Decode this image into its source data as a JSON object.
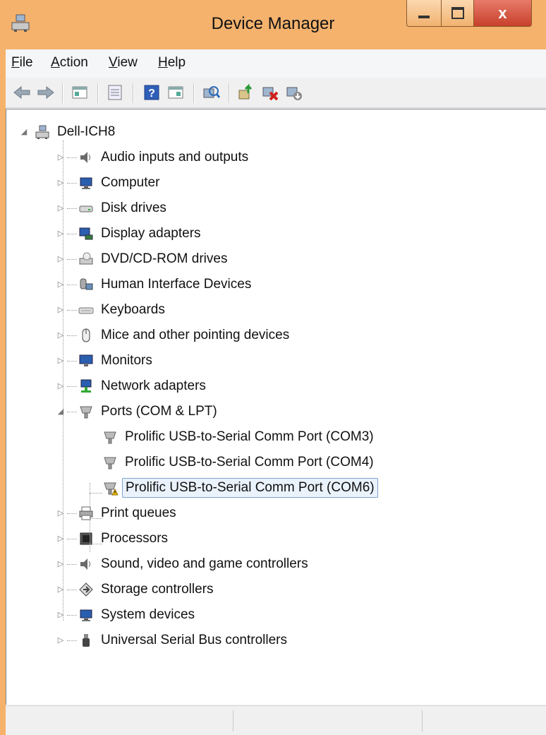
{
  "window": {
    "title": "Device Manager",
    "close_label": "x"
  },
  "menu": [
    {
      "label": "File",
      "accel": "F",
      "rest": "ile"
    },
    {
      "label": "Action",
      "accel": "A",
      "rest": "ction"
    },
    {
      "label": "View",
      "accel": "V",
      "rest": "iew"
    },
    {
      "label": "Help",
      "accel": "H",
      "rest": "elp"
    }
  ],
  "toolbar": [
    {
      "icon": "back-arrow-icon"
    },
    {
      "icon": "forward-arrow-icon"
    },
    {
      "icon": "show-hide-console-tree-icon"
    },
    {
      "icon": "properties-icon"
    },
    {
      "icon": "help-icon"
    },
    {
      "icon": "show-action-pane-icon"
    },
    {
      "icon": "scan-hardware-icon"
    },
    {
      "icon": "update-driver-icon"
    },
    {
      "icon": "uninstall-device-icon"
    },
    {
      "icon": "disable-device-icon"
    }
  ],
  "tree": {
    "root": "Dell-ICH8",
    "categories": [
      {
        "label": "Audio inputs and outputs",
        "icon": "speaker-icon",
        "expanded": false
      },
      {
        "label": "Computer",
        "icon": "computer-icon",
        "expanded": false
      },
      {
        "label": "Disk drives",
        "icon": "disk-drive-icon",
        "expanded": false
      },
      {
        "label": "Display adapters",
        "icon": "display-adapter-icon",
        "expanded": false
      },
      {
        "label": "DVD/CD-ROM drives",
        "icon": "dvd-drive-icon",
        "expanded": false
      },
      {
        "label": "Human Interface Devices",
        "icon": "hid-icon",
        "expanded": false
      },
      {
        "label": "Keyboards",
        "icon": "keyboard-icon",
        "expanded": false
      },
      {
        "label": "Mice and other pointing devices",
        "icon": "mouse-icon",
        "expanded": false
      },
      {
        "label": "Monitors",
        "icon": "monitor-icon",
        "expanded": false
      },
      {
        "label": "Network adapters",
        "icon": "network-adapter-icon",
        "expanded": false
      },
      {
        "label": "Ports (COM & LPT)",
        "icon": "port-icon",
        "expanded": true,
        "children": [
          {
            "label": "Prolific USB-to-Serial Comm Port (COM3)",
            "icon": "port-icon",
            "warning": false
          },
          {
            "label": "Prolific USB-to-Serial Comm Port (COM4)",
            "icon": "port-icon",
            "warning": false
          },
          {
            "label": "Prolific USB-to-Serial Comm Port (COM6)",
            "icon": "port-warning-icon",
            "warning": true,
            "selected": true
          }
        ]
      },
      {
        "label": "Print queues",
        "icon": "printer-icon",
        "expanded": false
      },
      {
        "label": "Processors",
        "icon": "processor-icon",
        "expanded": false
      },
      {
        "label": "Sound, video and game controllers",
        "icon": "speaker-icon",
        "expanded": false
      },
      {
        "label": "Storage controllers",
        "icon": "storage-controller-icon",
        "expanded": false
      },
      {
        "label": "System devices",
        "icon": "computer-icon",
        "expanded": false
      },
      {
        "label": "Universal Serial Bus controllers",
        "icon": "usb-icon",
        "expanded": false
      }
    ]
  },
  "colors": {
    "frame": "#f4b26d",
    "selection_border": "#7da2ce",
    "selection_fill": "#eaf2fc"
  }
}
